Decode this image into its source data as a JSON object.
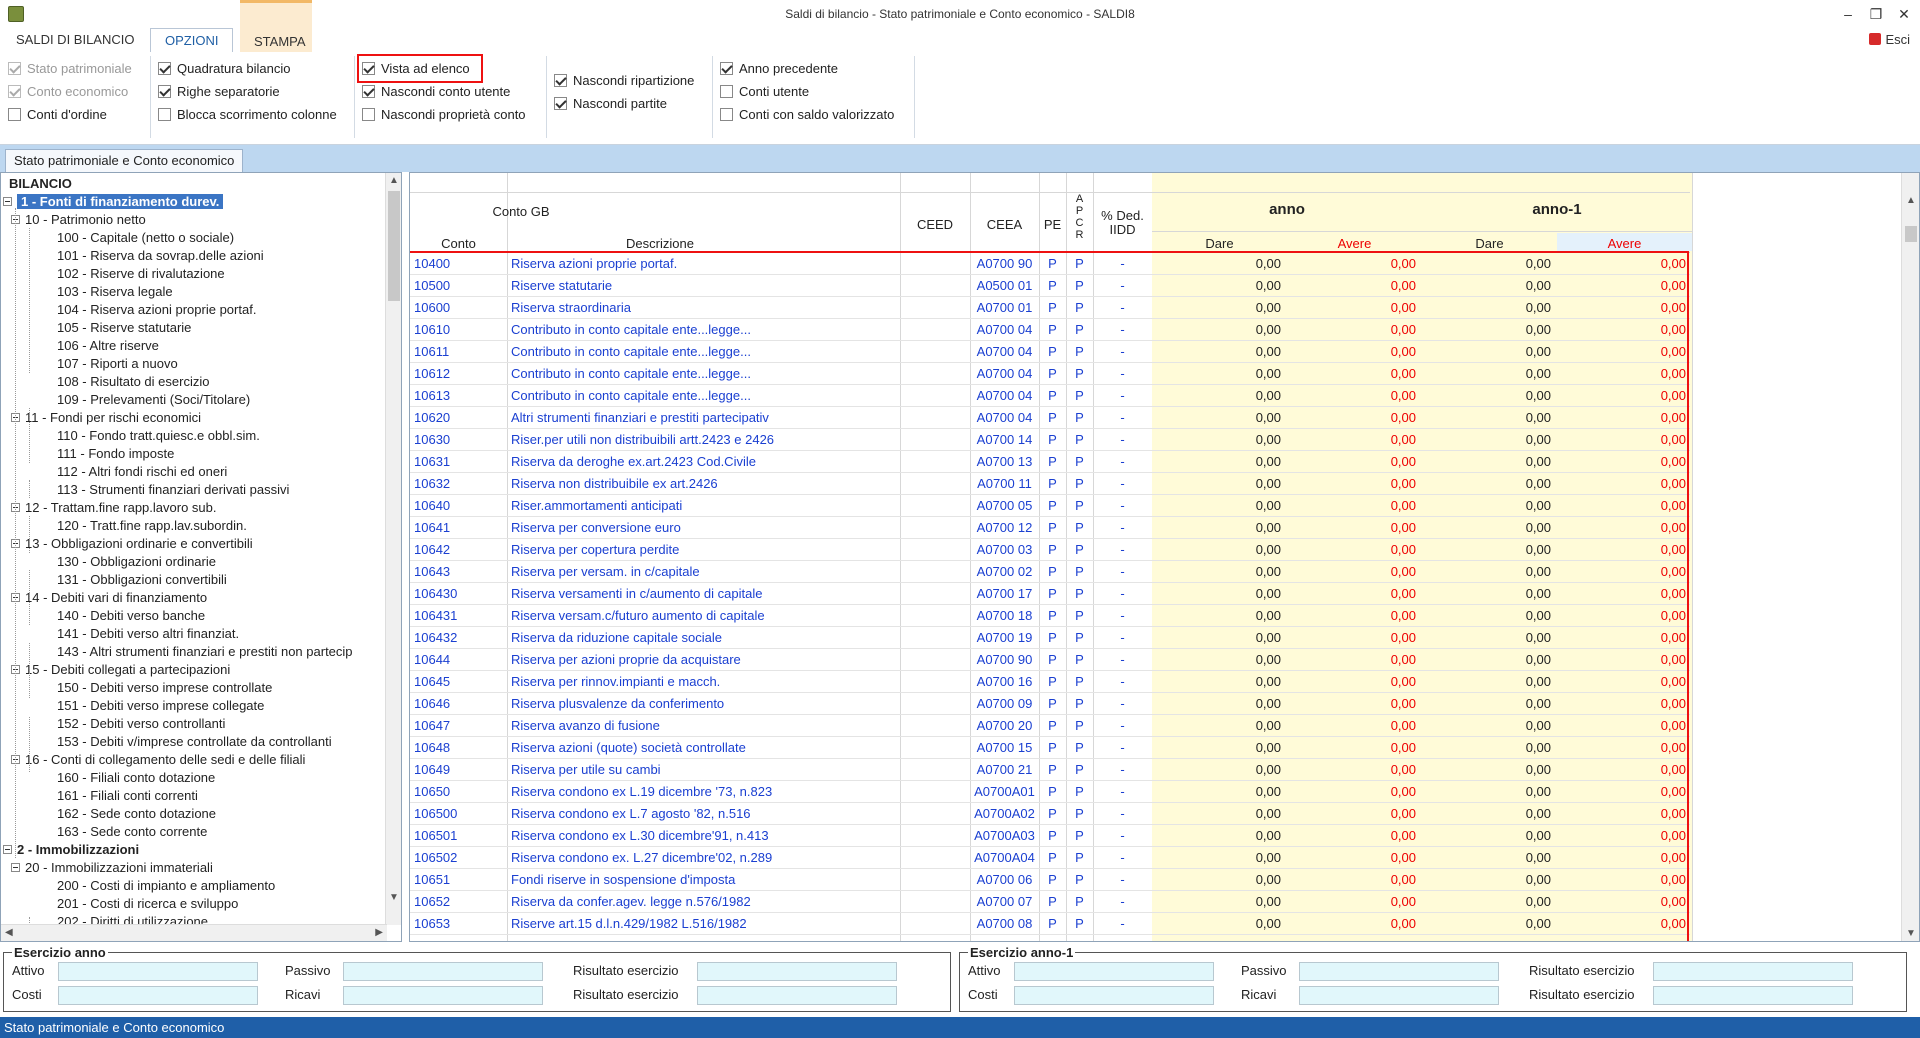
{
  "window": {
    "title": "Saldi di bilancio - Stato patrimoniale e Conto economico - SALDI8",
    "minimize": "–",
    "restore": "❐",
    "close": "✕"
  },
  "ribbon_tabs": [
    {
      "label": "SALDI DI BILANCIO"
    },
    {
      "label": "OPZIONI"
    },
    {
      "label": "STAMPA"
    }
  ],
  "exit_label": "Esci",
  "options": [
    {
      "label": "Stato patrimoniale",
      "checked": true,
      "disabled": true
    },
    {
      "label": "Conto economico",
      "checked": true,
      "disabled": true
    },
    {
      "label": "Conti d'ordine",
      "checked": false,
      "disabled": false
    },
    {
      "label": "Quadratura bilancio",
      "checked": true,
      "disabled": false
    },
    {
      "label": "Righe separatorie",
      "checked": true,
      "disabled": false
    },
    {
      "label": "Blocca scorrimento colonne",
      "checked": false,
      "disabled": false
    },
    {
      "label": "Vista ad elenco",
      "checked": true,
      "disabled": false
    },
    {
      "label": "Nascondi conto utente",
      "checked": true,
      "disabled": false
    },
    {
      "label": "Nascondi proprietà conto",
      "checked": false,
      "disabled": false
    },
    {
      "label": "Nascondi ripartizione",
      "checked": true,
      "disabled": false
    },
    {
      "label": "Nascondi partite",
      "checked": true,
      "disabled": false
    },
    {
      "label": "Anno precedente",
      "checked": true,
      "disabled": false
    },
    {
      "label": "Conti utente",
      "checked": false,
      "disabled": false
    },
    {
      "label": "Conti con saldo valorizzato",
      "checked": false,
      "disabled": false
    }
  ],
  "doc_tab": "Stato patrimoniale e Conto economico",
  "tree": [
    {
      "label": "BILANCIO",
      "level": 0,
      "bold": true
    },
    {
      "label": "1 - Fonti di finanziamento durev.",
      "level": 1,
      "bold": true,
      "selected": true,
      "expander": true
    },
    {
      "label": "10 - Patrimonio netto",
      "level": 2,
      "expander": true
    },
    {
      "label": "100 - Capitale (netto o sociale)",
      "level": 3
    },
    {
      "label": "101 - Riserva da sovrap.delle azioni",
      "level": 3
    },
    {
      "label": "102 - Riserve di rivalutazione",
      "level": 3
    },
    {
      "label": "103 - Riserva legale",
      "level": 3
    },
    {
      "label": "104 - Riserva azioni proprie portaf.",
      "level": 3
    },
    {
      "label": "105 - Riserve statutarie",
      "level": 3
    },
    {
      "label": "106 - Altre riserve",
      "level": 3
    },
    {
      "label": "107 - Riporti a nuovo",
      "level": 3
    },
    {
      "label": "108 - Risultato di esercizio",
      "level": 3
    },
    {
      "label": "109 - Prelevamenti (Soci/Titolare)",
      "level": 3
    },
    {
      "label": "11 - Fondi per rischi economici",
      "level": 2,
      "expander": true
    },
    {
      "label": "110 - Fondo tratt.quiesc.e obbl.sim.",
      "level": 3
    },
    {
      "label": "111 - Fondo imposte",
      "level": 3
    },
    {
      "label": "112 - Altri fondi rischi ed oneri",
      "level": 3
    },
    {
      "label": "113 - Strumenti finanziari derivati passivi",
      "level": 3
    },
    {
      "label": "12 - Trattam.fine rapp.lavoro sub.",
      "level": 2,
      "expander": true
    },
    {
      "label": "120 - Tratt.fine rapp.lav.subordin.",
      "level": 3
    },
    {
      "label": "13 - Obbligazioni ordinarie e convertibili",
      "level": 2,
      "expander": true
    },
    {
      "label": "130 - Obbligazioni ordinarie",
      "level": 3
    },
    {
      "label": "131 - Obbligazioni convertibili",
      "level": 3
    },
    {
      "label": "14 - Debiti vari di finanziamento",
      "level": 2,
      "expander": true
    },
    {
      "label": "140 - Debiti verso banche",
      "level": 3
    },
    {
      "label": "141 - Debiti verso altri finanziat.",
      "level": 3
    },
    {
      "label": "143 - Altri strumenti finanziari e prestiti non partecip",
      "level": 3
    },
    {
      "label": "15 - Debiti collegati a partecipazioni",
      "level": 2,
      "expander": true
    },
    {
      "label": "150 - Debiti verso imprese controllate",
      "level": 3
    },
    {
      "label": "151 - Debiti verso imprese collegate",
      "level": 3
    },
    {
      "label": "152 - Debiti verso controllanti",
      "level": 3
    },
    {
      "label": "153 - Debiti v/imprese controllate da controllanti",
      "level": 3
    },
    {
      "label": "16 - Conti di collegamento delle sedi e delle filiali",
      "level": 2,
      "expander": true
    },
    {
      "label": "160 - Filiali conto dotazione",
      "level": 3
    },
    {
      "label": "161 - Filiali conti correnti",
      "level": 3
    },
    {
      "label": "162 - Sede conto dotazione",
      "level": 3
    },
    {
      "label": "163 - Sede conto corrente",
      "level": 3
    },
    {
      "label": "2 - Immobilizzazioni",
      "level": 1,
      "bold": true,
      "expander": true
    },
    {
      "label": "20 - Immobilizzazioni immateriali",
      "level": 2,
      "expander": true
    },
    {
      "label": "200 - Costi di impianto e ampliamento",
      "level": 3
    },
    {
      "label": "201 - Costi di ricerca e sviluppo",
      "level": 3
    },
    {
      "label": "202 - Diritti di utilizzazione",
      "level": 3
    }
  ],
  "grid": {
    "headers": {
      "conto_gb": "Conto GB",
      "conto": "Conto",
      "descrizione": "Descrizione",
      "ceed": "CEED",
      "ceea": "CEEA",
      "pe": "PE",
      "apcr": [
        "A",
        "P",
        "C",
        "R"
      ],
      "ded": "% Ded.\nIIDD",
      "anno": "anno",
      "anno1": "anno-1",
      "dare": "Dare",
      "avere": "Avere"
    },
    "rows": [
      {
        "conto": "10400",
        "descr": "Riserva azioni proprie portaf.",
        "ceea": "A0700 90",
        "pe": "P",
        "apcr": "P",
        "ded": "-",
        "v": [
          "0,00",
          "0,00",
          "0,00",
          "0,00"
        ]
      },
      {
        "conto": "10500",
        "descr": "Riserve statutarie",
        "ceea": "A0500 01",
        "pe": "P",
        "apcr": "P",
        "ded": "-",
        "v": [
          "0,00",
          "0,00",
          "0,00",
          "0,00"
        ]
      },
      {
        "conto": "10600",
        "descr": "Riserva straordinaria",
        "ceea": "A0700 01",
        "pe": "P",
        "apcr": "P",
        "ded": "-",
        "v": [
          "0,00",
          "0,00",
          "0,00",
          "0,00"
        ]
      },
      {
        "conto": "10610",
        "descr": "Contributo in conto capitale ente...legge...",
        "ceea": "A0700 04",
        "pe": "P",
        "apcr": "P",
        "ded": "-",
        "v": [
          "0,00",
          "0,00",
          "0,00",
          "0,00"
        ]
      },
      {
        "conto": "10611",
        "descr": "Contributo in conto capitale ente...legge...",
        "ceea": "A0700 04",
        "pe": "P",
        "apcr": "P",
        "ded": "-",
        "v": [
          "0,00",
          "0,00",
          "0,00",
          "0,00"
        ]
      },
      {
        "conto": "10612",
        "descr": "Contributo in conto capitale ente...legge...",
        "ceea": "A0700 04",
        "pe": "P",
        "apcr": "P",
        "ded": "-",
        "v": [
          "0,00",
          "0,00",
          "0,00",
          "0,00"
        ]
      },
      {
        "conto": "10613",
        "descr": "Contributo in conto capitale ente...legge...",
        "ceea": "A0700 04",
        "pe": "P",
        "apcr": "P",
        "ded": "-",
        "v": [
          "0,00",
          "0,00",
          "0,00",
          "0,00"
        ]
      },
      {
        "conto": "10620",
        "descr": "Altri strumenti finanziari e prestiti partecipativ",
        "ceea": "A0700 04",
        "pe": "P",
        "apcr": "P",
        "ded": "-",
        "v": [
          "0,00",
          "0,00",
          "0,00",
          "0,00"
        ]
      },
      {
        "conto": "10630",
        "descr": "Riser.per utili non distribuibili artt.2423 e 2426",
        "ceea": "A0700 14",
        "pe": "P",
        "apcr": "P",
        "ded": "-",
        "v": [
          "0,00",
          "0,00",
          "0,00",
          "0,00"
        ]
      },
      {
        "conto": "10631",
        "descr": "Riserva da deroghe ex.art.2423 Cod.Civile",
        "ceea": "A0700 13",
        "pe": "P",
        "apcr": "P",
        "ded": "-",
        "v": [
          "0,00",
          "0,00",
          "0,00",
          "0,00"
        ]
      },
      {
        "conto": "10632",
        "descr": "Riserva non distribuibile ex art.2426",
        "ceea": "A0700 11",
        "pe": "P",
        "apcr": "P",
        "ded": "-",
        "v": [
          "0,00",
          "0,00",
          "0,00",
          "0,00"
        ]
      },
      {
        "conto": "10640",
        "descr": "Riser.ammortamenti anticipati",
        "ceea": "A0700 05",
        "pe": "P",
        "apcr": "P",
        "ded": "-",
        "v": [
          "0,00",
          "0,00",
          "0,00",
          "0,00"
        ]
      },
      {
        "conto": "10641",
        "descr": "Riserva per conversione euro",
        "ceea": "A0700 12",
        "pe": "P",
        "apcr": "P",
        "ded": "-",
        "v": [
          "0,00",
          "0,00",
          "0,00",
          "0,00"
        ]
      },
      {
        "conto": "10642",
        "descr": "Riserva per copertura perdite",
        "ceea": "A0700 03",
        "pe": "P",
        "apcr": "P",
        "ded": "-",
        "v": [
          "0,00",
          "0,00",
          "0,00",
          "0,00"
        ]
      },
      {
        "conto": "10643",
        "descr": "Riserva per versam. in c/capitale",
        "ceea": "A0700 02",
        "pe": "P",
        "apcr": "P",
        "ded": "-",
        "v": [
          "0,00",
          "0,00",
          "0,00",
          "0,00"
        ]
      },
      {
        "conto": "106430",
        "descr": "Riserva versamenti in c/aumento di capitale",
        "ceea": "A0700 17",
        "pe": "P",
        "apcr": "P",
        "ded": "-",
        "v": [
          "0,00",
          "0,00",
          "0,00",
          "0,00"
        ]
      },
      {
        "conto": "106431",
        "descr": "Riserva versam.c/futuro aumento di capitale",
        "ceea": "A0700 18",
        "pe": "P",
        "apcr": "P",
        "ded": "-",
        "v": [
          "0,00",
          "0,00",
          "0,00",
          "0,00"
        ]
      },
      {
        "conto": "106432",
        "descr": "Riserva da riduzione capitale sociale",
        "ceea": "A0700 19",
        "pe": "P",
        "apcr": "P",
        "ded": "-",
        "v": [
          "0,00",
          "0,00",
          "0,00",
          "0,00"
        ]
      },
      {
        "conto": "10644",
        "descr": "Riserva per azioni proprie da acquistare",
        "ceea": "A0700 90",
        "pe": "P",
        "apcr": "P",
        "ded": "-",
        "v": [
          "0,00",
          "0,00",
          "0,00",
          "0,00"
        ]
      },
      {
        "conto": "10645",
        "descr": "Riserva per rinnov.impianti e macch.",
        "ceea": "A0700 16",
        "pe": "P",
        "apcr": "P",
        "ded": "-",
        "v": [
          "0,00",
          "0,00",
          "0,00",
          "0,00"
        ]
      },
      {
        "conto": "10646",
        "descr": "Riserva plusvalenze da conferimento",
        "ceea": "A0700 09",
        "pe": "P",
        "apcr": "P",
        "ded": "-",
        "v": [
          "0,00",
          "0,00",
          "0,00",
          "0,00"
        ]
      },
      {
        "conto": "10647",
        "descr": "Riserva avanzo di fusione",
        "ceea": "A0700 20",
        "pe": "P",
        "apcr": "P",
        "ded": "-",
        "v": [
          "0,00",
          "0,00",
          "0,00",
          "0,00"
        ]
      },
      {
        "conto": "10648",
        "descr": "Riserva azioni (quote) società controllate",
        "ceea": "A0700 15",
        "pe": "P",
        "apcr": "P",
        "ded": "-",
        "v": [
          "0,00",
          "0,00",
          "0,00",
          "0,00"
        ]
      },
      {
        "conto": "10649",
        "descr": "Riserva per utile su cambi",
        "ceea": "A0700 21",
        "pe": "P",
        "apcr": "P",
        "ded": "-",
        "v": [
          "0,00",
          "0,00",
          "0,00",
          "0,00"
        ]
      },
      {
        "conto": "10650",
        "descr": "Riserva condono ex L.19 dicembre '73, n.823",
        "ceea": "A0700A01",
        "pe": "P",
        "apcr": "P",
        "ded": "-",
        "v": [
          "0,00",
          "0,00",
          "0,00",
          "0,00"
        ]
      },
      {
        "conto": "106500",
        "descr": "Riserva condono ex L.7 agosto '82, n.516",
        "ceea": "A0700A02",
        "pe": "P",
        "apcr": "P",
        "ded": "-",
        "v": [
          "0,00",
          "0,00",
          "0,00",
          "0,00"
        ]
      },
      {
        "conto": "106501",
        "descr": "Riserva condono ex L.30 dicembre'91, n.413",
        "ceea": "A0700A03",
        "pe": "P",
        "apcr": "P",
        "ded": "-",
        "v": [
          "0,00",
          "0,00",
          "0,00",
          "0,00"
        ]
      },
      {
        "conto": "106502",
        "descr": "Riserva condono ex. L.27 dicembre'02, n.289",
        "ceea": "A0700A04",
        "pe": "P",
        "apcr": "P",
        "ded": "-",
        "v": [
          "0,00",
          "0,00",
          "0,00",
          "0,00"
        ]
      },
      {
        "conto": "10651",
        "descr": "Fondi riserve in sospensione d'imposta",
        "ceea": "A0700 06",
        "pe": "P",
        "apcr": "P",
        "ded": "-",
        "v": [
          "0,00",
          "0,00",
          "0,00",
          "0,00"
        ]
      },
      {
        "conto": "10652",
        "descr": "Riserva da confer.agev. legge n.576/1982",
        "ceea": "A0700 07",
        "pe": "P",
        "apcr": "P",
        "ded": "-",
        "v": [
          "0,00",
          "0,00",
          "0,00",
          "0,00"
        ]
      },
      {
        "conto": "10653",
        "descr": "Riserve art.15 d.l.n.429/1982 L.516/1982",
        "ceea": "A0700 08",
        "pe": "P",
        "apcr": "P",
        "ded": "-",
        "v": [
          "0,00",
          "0,00",
          "0,00",
          "0,00"
        ]
      }
    ]
  },
  "summary": {
    "left": {
      "title": "Esercizio anno",
      "attivo": "Attivo",
      "costi": "Costi",
      "passivo": "Passivo",
      "ricavi": "Ricavi",
      "ris1": "Risultato esercizio",
      "ris2": "Risultato esercizio"
    },
    "right": {
      "title": "Esercizio anno-1",
      "attivo": "Attivo",
      "costi": "Costi",
      "passivo": "Passivo",
      "ricavi": "Ricavi",
      "ris1": "Risultato esercizio",
      "ris2": "Risultato esercizio"
    }
  },
  "status": "Stato patrimoniale e Conto economico"
}
